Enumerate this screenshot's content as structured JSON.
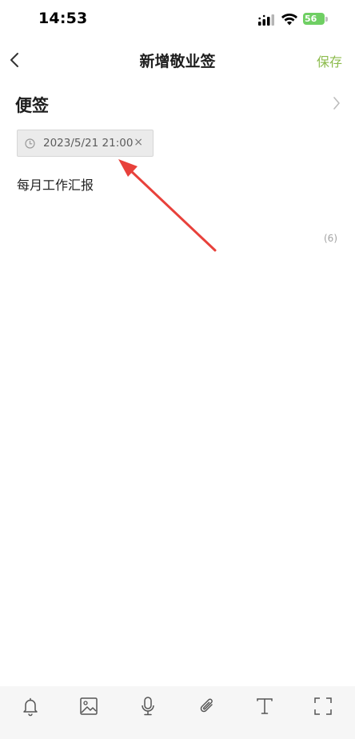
{
  "status_bar": {
    "time": "14:53",
    "battery_level": "56"
  },
  "header": {
    "title": "新增敬业签",
    "save_label": "保存"
  },
  "category": {
    "label": "便签"
  },
  "reminder": {
    "datetime": "2023/5/21 21:00",
    "close_glyph": "×"
  },
  "note": {
    "content": "每月工作汇报",
    "char_count": "(6)"
  },
  "toolbar": {
    "items": [
      "bell-icon",
      "image-icon",
      "microphone-icon",
      "paperclip-icon",
      "text-format-icon",
      "fullscreen-icon"
    ]
  },
  "colors": {
    "accent": "#8cbb4c",
    "annotation": "#e8413b",
    "battery": "#6fcf63"
  }
}
